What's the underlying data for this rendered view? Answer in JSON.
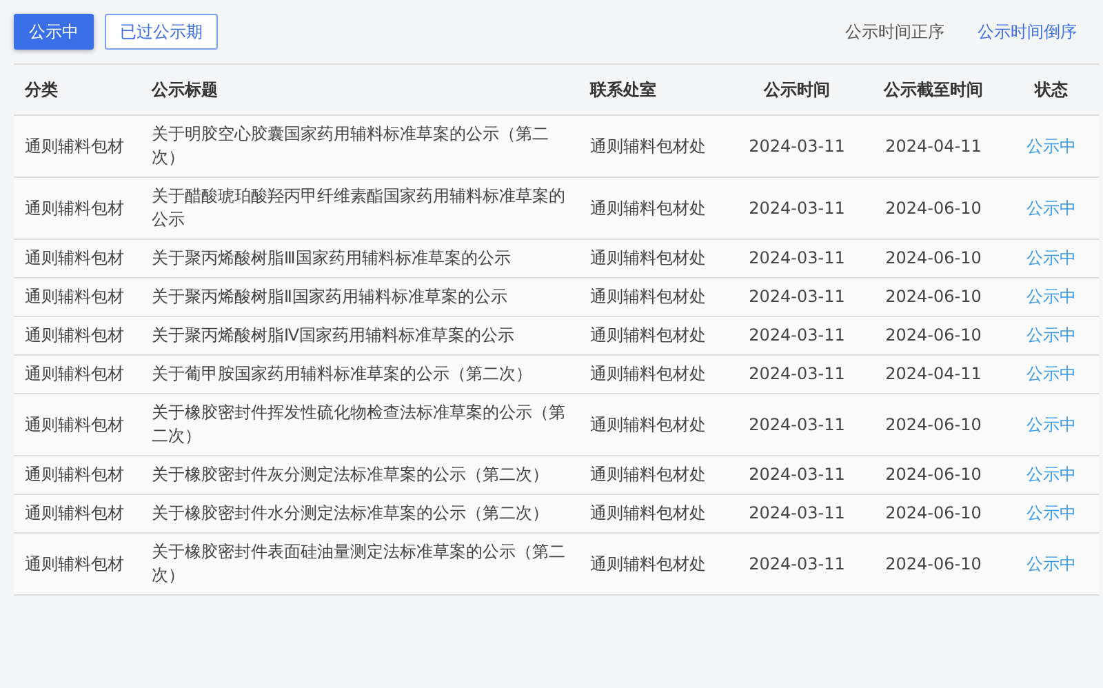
{
  "tabs": [
    {
      "label": "公示中",
      "selected": true
    },
    {
      "label": "已过公示期",
      "selected": false
    }
  ],
  "sort_links": [
    {
      "label": "公示时间正序",
      "selected": false
    },
    {
      "label": "公示时间倒序",
      "selected": true
    }
  ],
  "table": {
    "columns": [
      "分类",
      "公示标题",
      "联系处室",
      "公示时间",
      "公示截至时间",
      "状态"
    ],
    "rows": [
      {
        "category": "通则辅料包材",
        "title": "关于明胶空心胶囊国家药用辅料标准草案的公示（第二次）",
        "office": "通则辅料包材处",
        "start": "2024-03-11",
        "end": "2024-04-11",
        "status": "公示中"
      },
      {
        "category": "通则辅料包材",
        "title": "关于醋酸琥珀酸羟丙甲纤维素酯国家药用辅料标准草案的公示",
        "office": "通则辅料包材处",
        "start": "2024-03-11",
        "end": "2024-06-10",
        "status": "公示中"
      },
      {
        "category": "通则辅料包材",
        "title": "关于聚丙烯酸树脂Ⅲ国家药用辅料标准草案的公示",
        "office": "通则辅料包材处",
        "start": "2024-03-11",
        "end": "2024-06-10",
        "status": "公示中"
      },
      {
        "category": "通则辅料包材",
        "title": "关于聚丙烯酸树脂Ⅱ国家药用辅料标准草案的公示",
        "office": "通则辅料包材处",
        "start": "2024-03-11",
        "end": "2024-06-10",
        "status": "公示中"
      },
      {
        "category": "通则辅料包材",
        "title": "关于聚丙烯酸树脂Ⅳ国家药用辅料标准草案的公示",
        "office": "通则辅料包材处",
        "start": "2024-03-11",
        "end": "2024-06-10",
        "status": "公示中"
      },
      {
        "category": "通则辅料包材",
        "title": "关于葡甲胺国家药用辅料标准草案的公示（第二次）",
        "office": "通则辅料包材处",
        "start": "2024-03-11",
        "end": "2024-04-11",
        "status": "公示中"
      },
      {
        "category": "通则辅料包材",
        "title": "关于橡胶密封件挥发性硫化物检查法标准草案的公示（第二次）",
        "office": "通则辅料包材处",
        "start": "2024-03-11",
        "end": "2024-06-10",
        "status": "公示中"
      },
      {
        "category": "通则辅料包材",
        "title": "关于橡胶密封件灰分测定法标准草案的公示（第二次）",
        "office": "通则辅料包材处",
        "start": "2024-03-11",
        "end": "2024-06-10",
        "status": "公示中"
      },
      {
        "category": "通则辅料包材",
        "title": "关于橡胶密封件水分测定法标准草案的公示（第二次）",
        "office": "通则辅料包材处",
        "start": "2024-03-11",
        "end": "2024-06-10",
        "status": "公示中"
      },
      {
        "category": "通则辅料包材",
        "title": "关于橡胶密封件表面硅油量测定法标准草案的公示（第二次）",
        "office": "通则辅料包材处",
        "start": "2024-03-11",
        "end": "2024-06-10",
        "status": "公示中"
      }
    ]
  }
}
